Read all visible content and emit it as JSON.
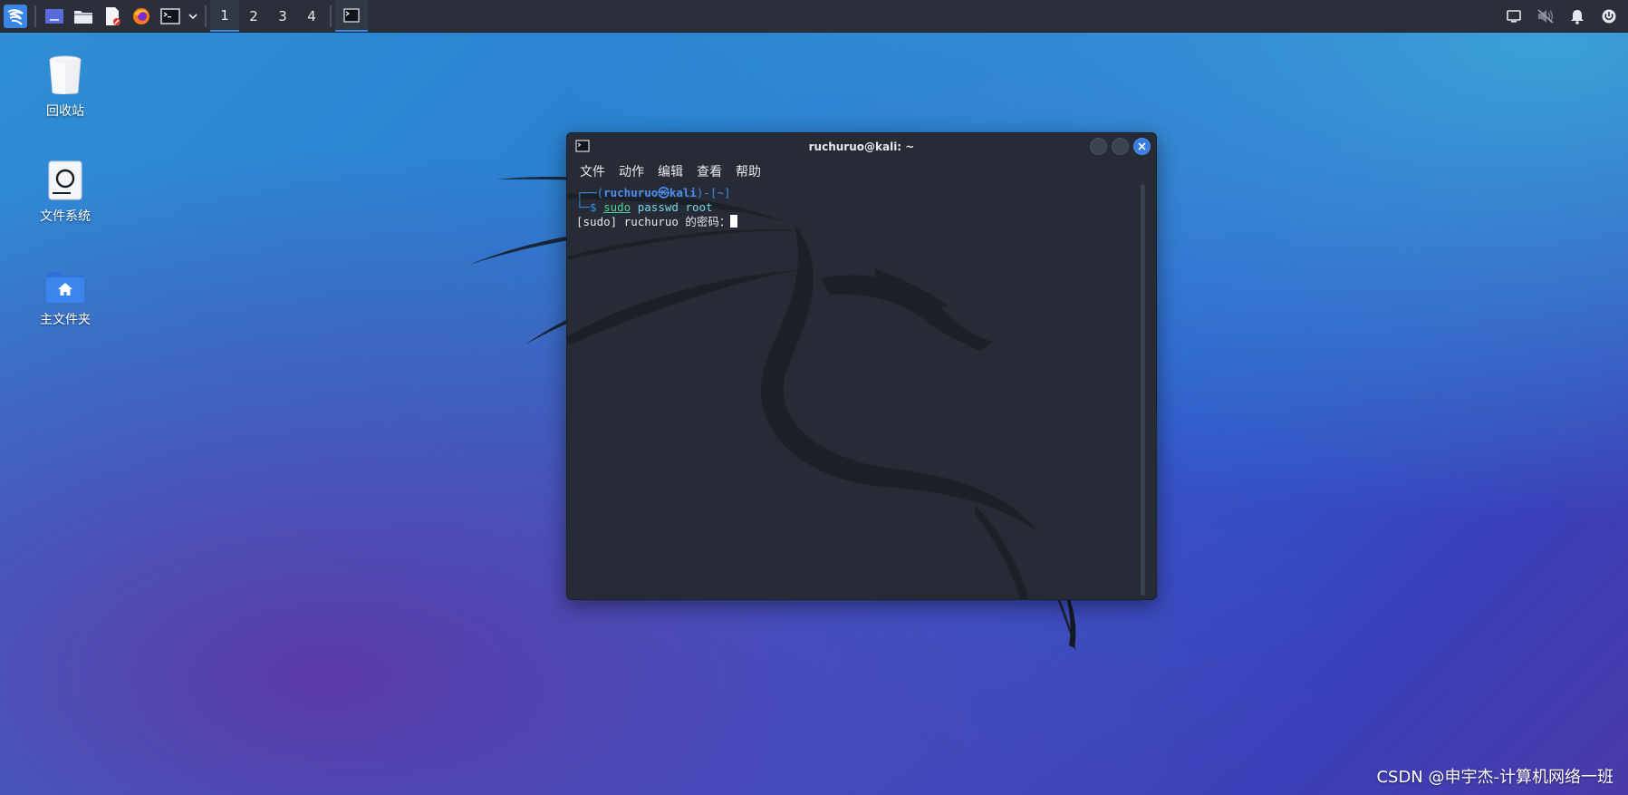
{
  "taskbar": {
    "workspaces": [
      "1",
      "2",
      "3",
      "4"
    ]
  },
  "desktop": {
    "icons": [
      {
        "label": "回收站"
      },
      {
        "label": "文件系统"
      },
      {
        "label": "主文件夹"
      }
    ]
  },
  "terminal": {
    "title": "ruchuruo@kali: ~",
    "menu": [
      "文件",
      "动作",
      "编辑",
      "查看",
      "帮助"
    ],
    "prompt": {
      "open": "┌──(",
      "user": "ruchuruo㉿kali",
      "close": ")-[~]",
      "dollar": "└─$",
      "cmd": "sudo",
      "args": "passwd root"
    },
    "output_line": "[sudo] ruchuruo 的密码："
  },
  "watermark": "CSDN @申宇杰-计算机网络一班"
}
